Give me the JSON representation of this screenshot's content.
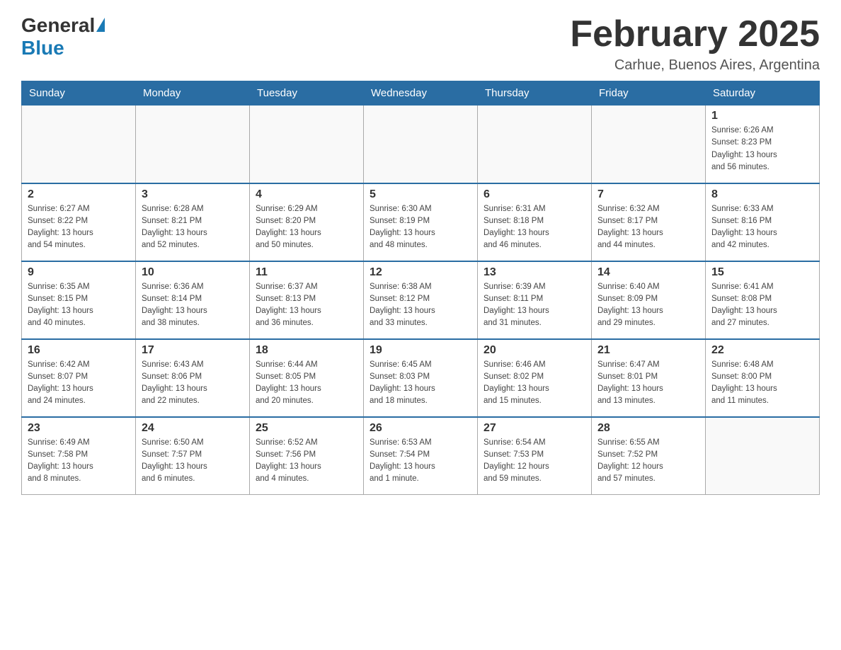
{
  "header": {
    "logo_general": "General",
    "logo_blue": "Blue",
    "title": "February 2025",
    "location": "Carhue, Buenos Aires, Argentina"
  },
  "days_of_week": [
    "Sunday",
    "Monday",
    "Tuesday",
    "Wednesday",
    "Thursday",
    "Friday",
    "Saturday"
  ],
  "weeks": [
    [
      {
        "day": "",
        "info": ""
      },
      {
        "day": "",
        "info": ""
      },
      {
        "day": "",
        "info": ""
      },
      {
        "day": "",
        "info": ""
      },
      {
        "day": "",
        "info": ""
      },
      {
        "day": "",
        "info": ""
      },
      {
        "day": "1",
        "info": "Sunrise: 6:26 AM\nSunset: 8:23 PM\nDaylight: 13 hours\nand 56 minutes."
      }
    ],
    [
      {
        "day": "2",
        "info": "Sunrise: 6:27 AM\nSunset: 8:22 PM\nDaylight: 13 hours\nand 54 minutes."
      },
      {
        "day": "3",
        "info": "Sunrise: 6:28 AM\nSunset: 8:21 PM\nDaylight: 13 hours\nand 52 minutes."
      },
      {
        "day": "4",
        "info": "Sunrise: 6:29 AM\nSunset: 8:20 PM\nDaylight: 13 hours\nand 50 minutes."
      },
      {
        "day": "5",
        "info": "Sunrise: 6:30 AM\nSunset: 8:19 PM\nDaylight: 13 hours\nand 48 minutes."
      },
      {
        "day": "6",
        "info": "Sunrise: 6:31 AM\nSunset: 8:18 PM\nDaylight: 13 hours\nand 46 minutes."
      },
      {
        "day": "7",
        "info": "Sunrise: 6:32 AM\nSunset: 8:17 PM\nDaylight: 13 hours\nand 44 minutes."
      },
      {
        "day": "8",
        "info": "Sunrise: 6:33 AM\nSunset: 8:16 PM\nDaylight: 13 hours\nand 42 minutes."
      }
    ],
    [
      {
        "day": "9",
        "info": "Sunrise: 6:35 AM\nSunset: 8:15 PM\nDaylight: 13 hours\nand 40 minutes."
      },
      {
        "day": "10",
        "info": "Sunrise: 6:36 AM\nSunset: 8:14 PM\nDaylight: 13 hours\nand 38 minutes."
      },
      {
        "day": "11",
        "info": "Sunrise: 6:37 AM\nSunset: 8:13 PM\nDaylight: 13 hours\nand 36 minutes."
      },
      {
        "day": "12",
        "info": "Sunrise: 6:38 AM\nSunset: 8:12 PM\nDaylight: 13 hours\nand 33 minutes."
      },
      {
        "day": "13",
        "info": "Sunrise: 6:39 AM\nSunset: 8:11 PM\nDaylight: 13 hours\nand 31 minutes."
      },
      {
        "day": "14",
        "info": "Sunrise: 6:40 AM\nSunset: 8:09 PM\nDaylight: 13 hours\nand 29 minutes."
      },
      {
        "day": "15",
        "info": "Sunrise: 6:41 AM\nSunset: 8:08 PM\nDaylight: 13 hours\nand 27 minutes."
      }
    ],
    [
      {
        "day": "16",
        "info": "Sunrise: 6:42 AM\nSunset: 8:07 PM\nDaylight: 13 hours\nand 24 minutes."
      },
      {
        "day": "17",
        "info": "Sunrise: 6:43 AM\nSunset: 8:06 PM\nDaylight: 13 hours\nand 22 minutes."
      },
      {
        "day": "18",
        "info": "Sunrise: 6:44 AM\nSunset: 8:05 PM\nDaylight: 13 hours\nand 20 minutes."
      },
      {
        "day": "19",
        "info": "Sunrise: 6:45 AM\nSunset: 8:03 PM\nDaylight: 13 hours\nand 18 minutes."
      },
      {
        "day": "20",
        "info": "Sunrise: 6:46 AM\nSunset: 8:02 PM\nDaylight: 13 hours\nand 15 minutes."
      },
      {
        "day": "21",
        "info": "Sunrise: 6:47 AM\nSunset: 8:01 PM\nDaylight: 13 hours\nand 13 minutes."
      },
      {
        "day": "22",
        "info": "Sunrise: 6:48 AM\nSunset: 8:00 PM\nDaylight: 13 hours\nand 11 minutes."
      }
    ],
    [
      {
        "day": "23",
        "info": "Sunrise: 6:49 AM\nSunset: 7:58 PM\nDaylight: 13 hours\nand 8 minutes."
      },
      {
        "day": "24",
        "info": "Sunrise: 6:50 AM\nSunset: 7:57 PM\nDaylight: 13 hours\nand 6 minutes."
      },
      {
        "day": "25",
        "info": "Sunrise: 6:52 AM\nSunset: 7:56 PM\nDaylight: 13 hours\nand 4 minutes."
      },
      {
        "day": "26",
        "info": "Sunrise: 6:53 AM\nSunset: 7:54 PM\nDaylight: 13 hours\nand 1 minute."
      },
      {
        "day": "27",
        "info": "Sunrise: 6:54 AM\nSunset: 7:53 PM\nDaylight: 12 hours\nand 59 minutes."
      },
      {
        "day": "28",
        "info": "Sunrise: 6:55 AM\nSunset: 7:52 PM\nDaylight: 12 hours\nand 57 minutes."
      },
      {
        "day": "",
        "info": ""
      }
    ]
  ]
}
